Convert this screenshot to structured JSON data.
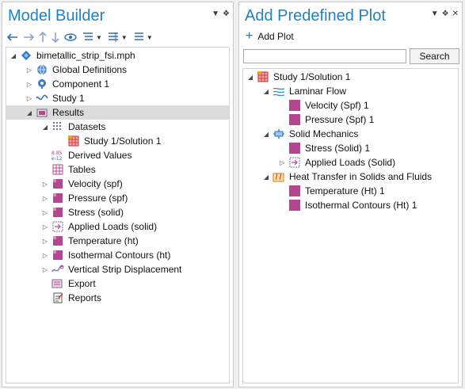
{
  "model_builder": {
    "title": "Model Builder",
    "toolbar": [
      "back-arrow-icon",
      "forward-arrow-icon",
      "up-arrow-icon",
      "down-arrow-icon",
      "show-icon",
      "expand-sections-icon",
      "collapse-icon",
      "list-icon"
    ],
    "tree": [
      {
        "label": "bimetallic_strip_fsi.mph",
        "icon": "model-file-icon",
        "expander": "collapse"
      },
      {
        "label": "Global Definitions",
        "icon": "globe-icon",
        "expander": "expand"
      },
      {
        "label": "Component 1",
        "icon": "component-icon",
        "expander": "expand"
      },
      {
        "label": "Study 1",
        "icon": "study-icon",
        "expander": "expand"
      },
      {
        "label": "Results",
        "icon": "results-icon",
        "expander": "collapse",
        "selected": true
      },
      {
        "label": "Datasets",
        "icon": "datasets-icon",
        "expander": "collapse"
      },
      {
        "label": "Study 1/Solution 1",
        "icon": "solution-icon",
        "expander": ""
      },
      {
        "label": "Derived Values",
        "icon": "derived-values-icon",
        "expander": ""
      },
      {
        "label": "Tables",
        "icon": "table-icon",
        "expander": ""
      },
      {
        "label": "Velocity (spf)",
        "icon": "plot-group-icon",
        "expander": "expand"
      },
      {
        "label": "Pressure (spf)",
        "icon": "plot-group-icon",
        "expander": "expand"
      },
      {
        "label": "Stress (solid)",
        "icon": "plot-group-icon",
        "expander": "expand"
      },
      {
        "label": "Applied Loads (solid)",
        "icon": "applied-loads-icon",
        "expander": "expand"
      },
      {
        "label": "Temperature (ht)",
        "icon": "plot-group-icon",
        "expander": "expand"
      },
      {
        "label": "Isothermal Contours (ht)",
        "icon": "plot-group-icon",
        "expander": "expand"
      },
      {
        "label": "Vertical Strip Displacement",
        "icon": "line-graph-icon",
        "expander": "expand"
      },
      {
        "label": "Export",
        "icon": "export-icon",
        "expander": ""
      },
      {
        "label": "Reports",
        "icon": "reports-icon",
        "expander": ""
      }
    ]
  },
  "add_predefined_plot": {
    "title": "Add Predefined Plot",
    "add_plot_label": "Add Plot",
    "search_value": "",
    "search_button_label": "Search",
    "tree": [
      {
        "label": "Study 1/Solution 1",
        "icon": "solution-icon",
        "expander": "collapse"
      },
      {
        "label": "Laminar Flow",
        "icon": "laminar-flow-icon",
        "expander": "collapse"
      },
      {
        "label": "Velocity (Spf) 1",
        "icon": "plot-square-icon",
        "expander": ""
      },
      {
        "label": "Pressure (Spf) 1",
        "icon": "plot-square-icon",
        "expander": ""
      },
      {
        "label": "Solid Mechanics",
        "icon": "solid-mechanics-icon",
        "expander": "collapse"
      },
      {
        "label": "Stress (Solid) 1",
        "icon": "plot-square-icon",
        "expander": ""
      },
      {
        "label": "Applied Loads (Solid)",
        "icon": "applied-loads-icon",
        "expander": "expand"
      },
      {
        "label": "Heat Transfer in Solids and Fluids",
        "icon": "heat-transfer-icon",
        "expander": "collapse"
      },
      {
        "label": "Temperature (Ht) 1",
        "icon": "plot-square-icon",
        "expander": ""
      },
      {
        "label": "Isothermal Contours (Ht) 1",
        "icon": "plot-square-icon",
        "expander": ""
      }
    ]
  },
  "colors": {
    "title_blue": "#1e82c8",
    "plot_magenta": "#b2478f",
    "selection_gray": "#dcdcdc"
  }
}
